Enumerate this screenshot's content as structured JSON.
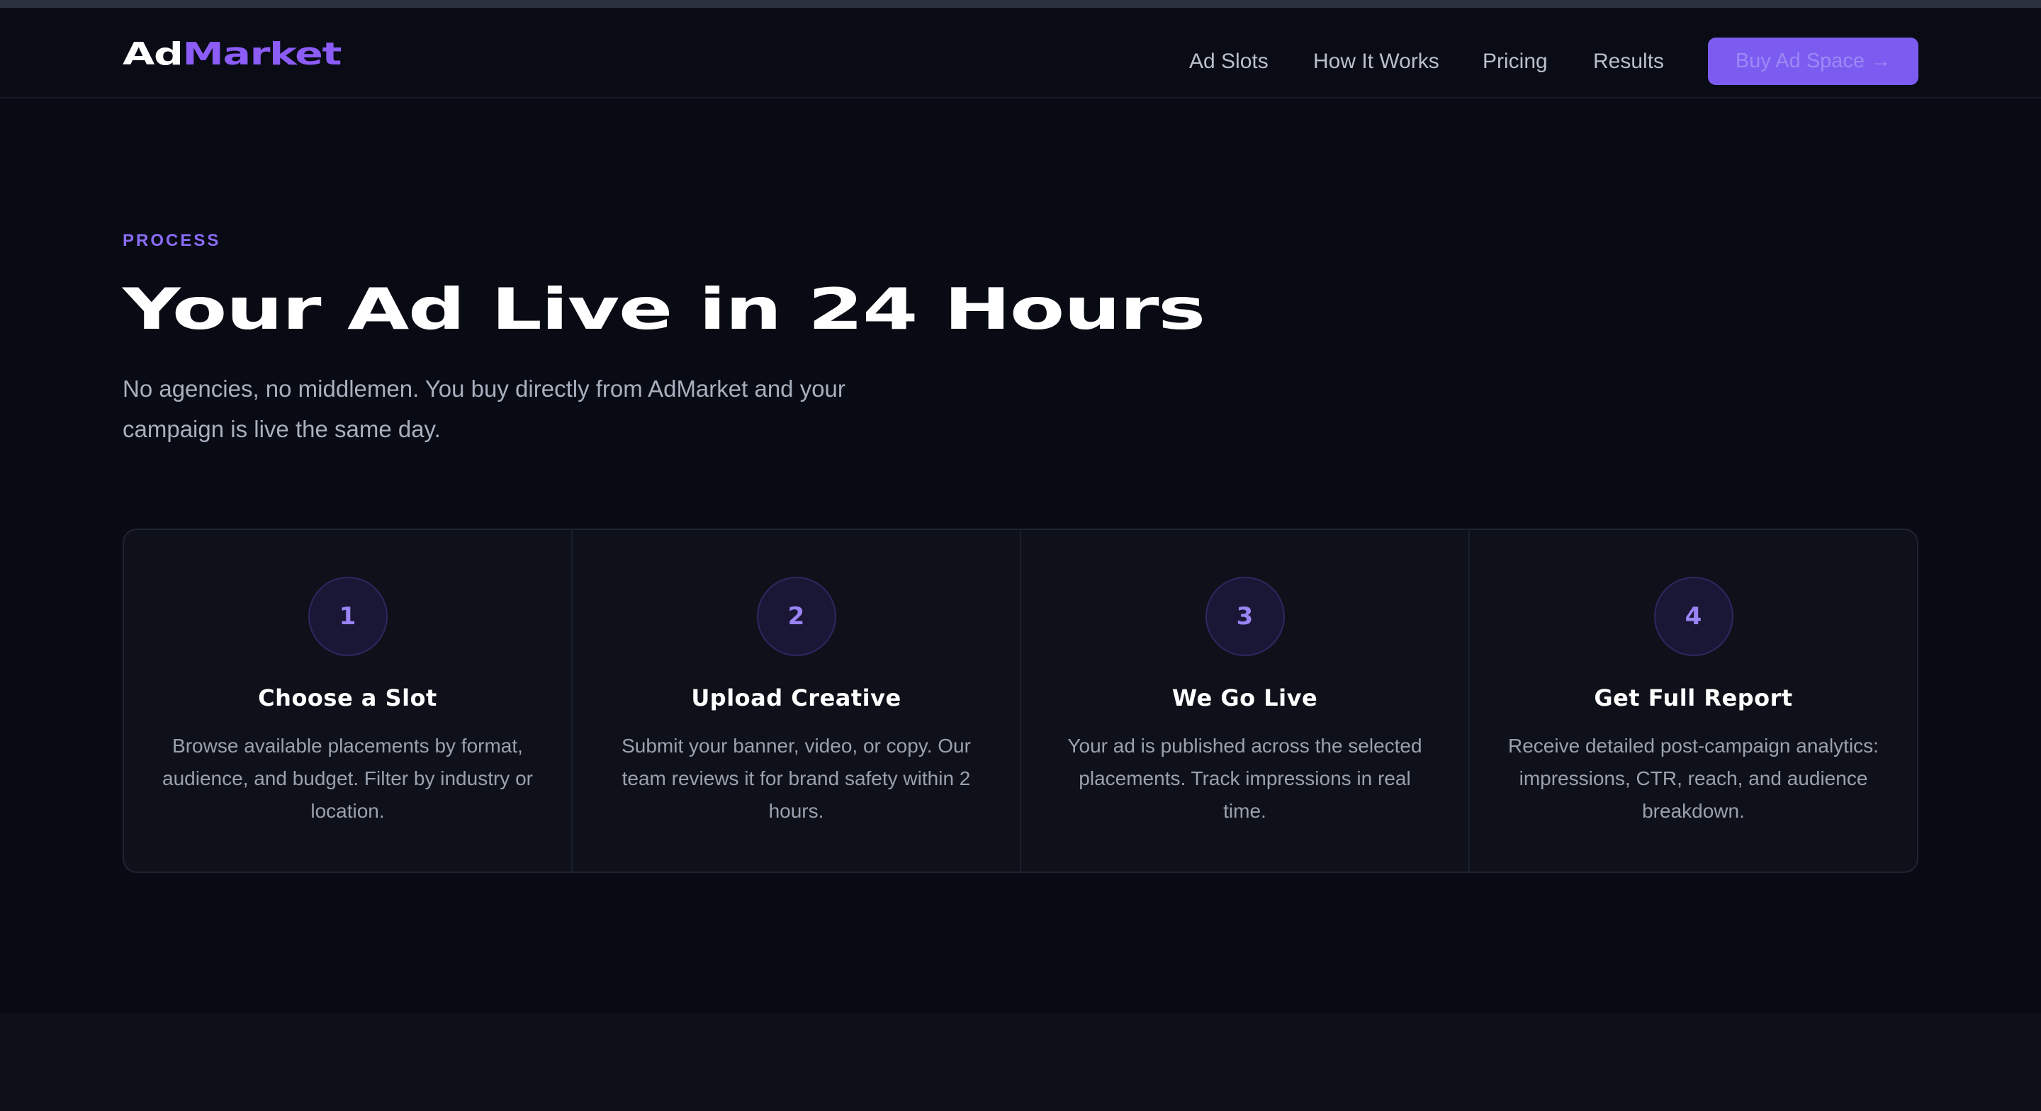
{
  "brand": {
    "name_part1": "Ad",
    "name_part2": "Market"
  },
  "nav": {
    "links": [
      "Ad Slots",
      "How It Works",
      "Pricing",
      "Results"
    ],
    "cta": "Buy Ad Space →"
  },
  "hero": {
    "eyebrow": "PROCESS",
    "title": "Your Ad Live in 24 Hours",
    "subtitle": "No agencies, no middlemen. You buy directly from AdMarket and your campaign is live the same day."
  },
  "steps": [
    {
      "number": "1",
      "title": "Choose a Slot",
      "description": "Browse available placements by format, audience, and budget. Filter by industry or location."
    },
    {
      "number": "2",
      "title": "Upload Creative",
      "description": "Submit your banner, video, or copy. Our team reviews it for brand safety within 2 hours."
    },
    {
      "number": "3",
      "title": "We Go Live",
      "description": "Your ad is published across the selected placements. Track impressions in real time."
    },
    {
      "number": "4",
      "title": "Get Full Report",
      "description": "Receive detailed post-campaign analytics: impressions, CTR, reach, and audience breakdown."
    }
  ],
  "colors": {
    "accent": "#8b5cf6",
    "background": "#080a14",
    "card": "#0e1119"
  }
}
